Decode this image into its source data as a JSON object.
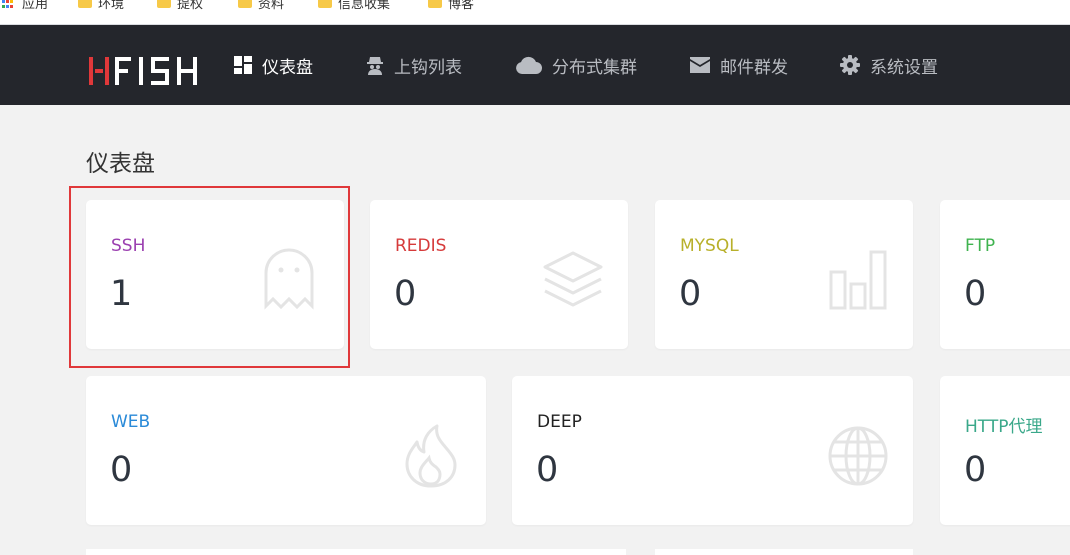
{
  "bookmarks": [
    {
      "label": "应用",
      "icon": "apps-grid-icon"
    },
    {
      "label": "环境",
      "icon": "folder-icon"
    },
    {
      "label": "提权",
      "icon": "folder-icon"
    },
    {
      "label": "资料",
      "icon": "folder-icon"
    },
    {
      "label": "信息收集",
      "icon": "folder-icon"
    },
    {
      "label": "博客",
      "icon": "folder-icon"
    }
  ],
  "logo": {
    "text": "HFISH",
    "color": "#e0383a"
  },
  "nav": [
    {
      "label": "仪表盘",
      "icon": "dashboard-icon",
      "active": true
    },
    {
      "label": "上钩列表",
      "icon": "spy-icon",
      "active": false
    },
    {
      "label": "分布式集群",
      "icon": "cloud-icon",
      "active": false
    },
    {
      "label": "邮件群发",
      "icon": "envelope-icon",
      "active": false
    },
    {
      "label": "系统设置",
      "icon": "gear-icon",
      "active": false
    }
  ],
  "page_title": "仪表盘",
  "cards": [
    {
      "label": "SSH",
      "value": "1",
      "color": "#9b3fb0",
      "icon": "ghost-icon"
    },
    {
      "label": "REDIS",
      "value": "0",
      "color": "#d63a3a",
      "icon": "layers-icon"
    },
    {
      "label": "MYSQL",
      "value": "0",
      "color": "#b8b02a",
      "icon": "bar-chart-icon"
    },
    {
      "label": "FTP",
      "value": "0",
      "color": "#3fb34f",
      "icon": ""
    },
    {
      "label": "WEB",
      "value": "0",
      "color": "#2a8ad8",
      "icon": "fire-icon"
    },
    {
      "label": "DEEP",
      "value": "0",
      "color": "#222222",
      "icon": "globe-icon"
    },
    {
      "label": "HTTP代理",
      "value": "0",
      "color": "#3aa88a",
      "icon": ""
    }
  ],
  "colors": {
    "navbar": "#24262c",
    "highlight": "#e0383a",
    "background": "#f2f2f2"
  }
}
